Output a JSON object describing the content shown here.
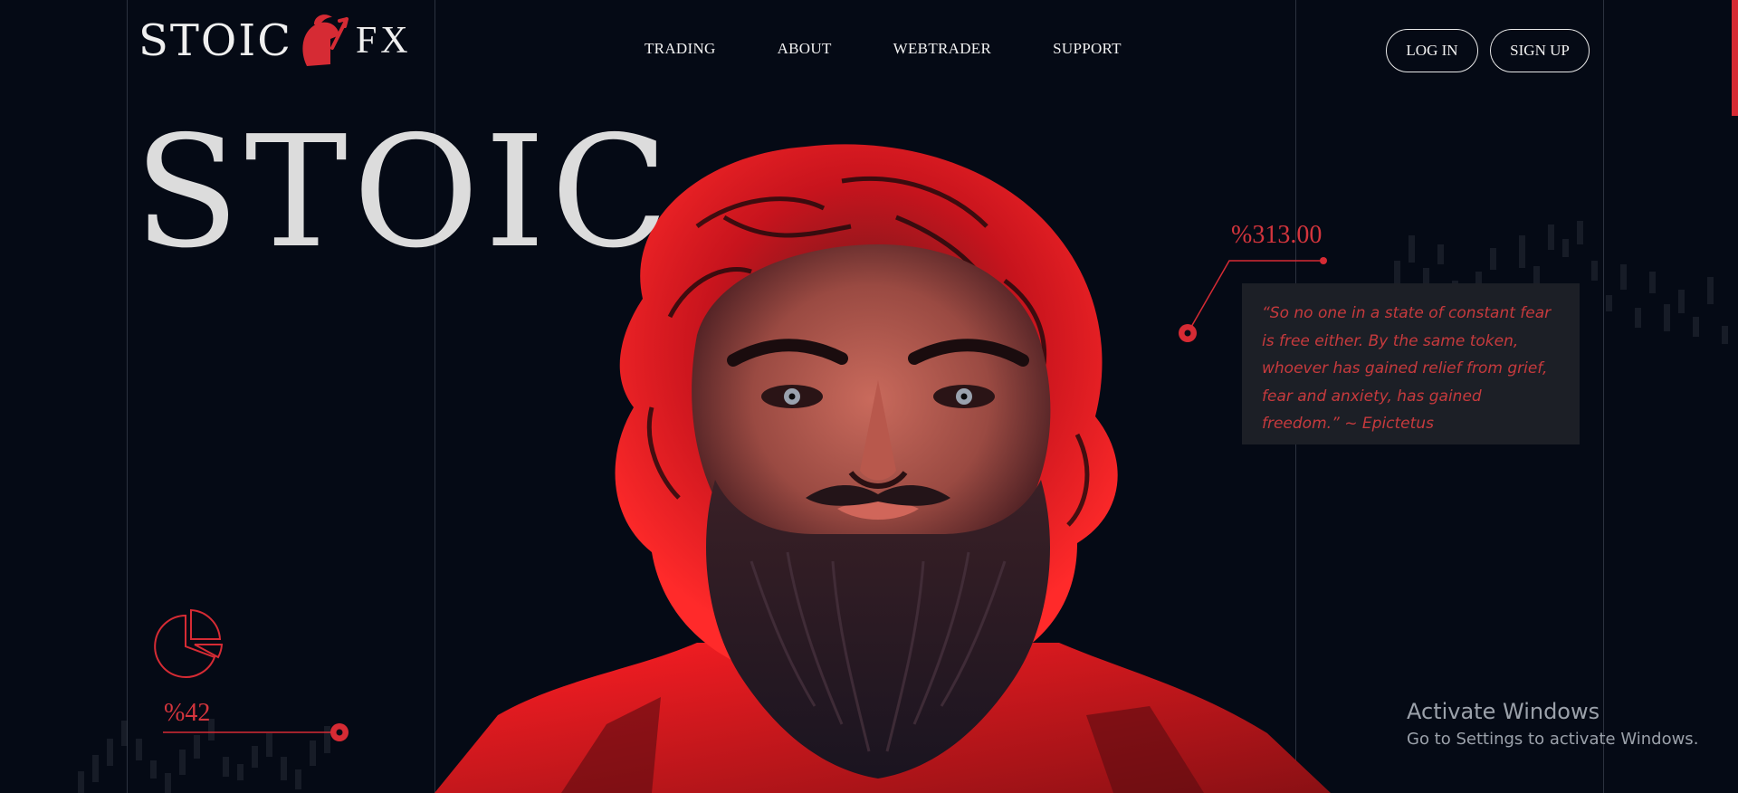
{
  "brand": {
    "logo_text": "STOIC",
    "logo_suffix": "FX"
  },
  "nav": {
    "items": [
      "TRADING",
      "ABOUT",
      "WEBTRADER",
      "SUPPORT"
    ]
  },
  "auth": {
    "login_label": "LOG IN",
    "signup_label": "SIGN UP"
  },
  "hero": {
    "title": "STOIC"
  },
  "stats": {
    "top_value": "%313.00",
    "bottom_value": "%42"
  },
  "quote": {
    "text": "“So no one in a state of constant fear is free either. By the same token, whoever has gained relief from grief, fear and anxiety, has gained freedom.” ~ Epictetus"
  },
  "watermark": {
    "title": "Activate Windows",
    "subtitle": "Go to Settings to activate Windows."
  },
  "colors": {
    "background": "#050a15",
    "accent": "#d62b34",
    "grid_line": "#2c323f"
  }
}
